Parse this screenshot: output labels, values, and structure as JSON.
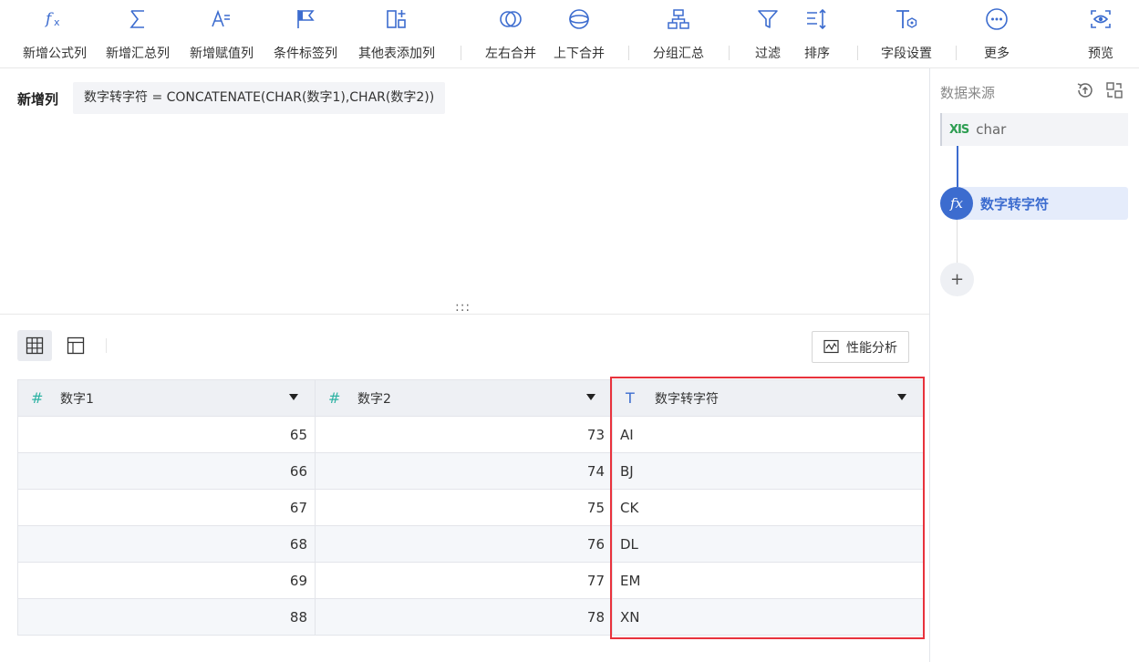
{
  "toolbar": {
    "items": [
      {
        "label": "新增公式列",
        "icon": "formula-icon"
      },
      {
        "label": "新增汇总列",
        "icon": "sigma-icon"
      },
      {
        "label": "新增赋值列",
        "icon": "assign-icon"
      },
      {
        "label": "条件标签列",
        "icon": "flag-icon"
      },
      {
        "label": "其他表添加列",
        "icon": "add-column-icon"
      },
      {
        "label": "左右合并",
        "icon": "horizontal-merge-icon"
      },
      {
        "label": "上下合并",
        "icon": "vertical-merge-icon"
      },
      {
        "label": "分组汇总",
        "icon": "group-icon"
      },
      {
        "label": "过滤",
        "icon": "filter-icon"
      },
      {
        "label": "排序",
        "icon": "sort-icon"
      },
      {
        "label": "字段设置",
        "icon": "field-settings-icon"
      },
      {
        "label": "更多",
        "icon": "more-icon"
      },
      {
        "label": "预览",
        "icon": "preview-icon"
      }
    ]
  },
  "formula": {
    "title": "新增列",
    "expression": "数字转字符 = CONCATENATE(CHAR(数字1),CHAR(数字2))"
  },
  "drag_handle": ":::",
  "perf_button": "性能分析",
  "table": {
    "columns": [
      {
        "name": "数字1",
        "type_icon": "#"
      },
      {
        "name": "数字2",
        "type_icon": "#"
      },
      {
        "name": "数字转字符",
        "type_icon": "T"
      }
    ],
    "rows": [
      [
        "65",
        "73",
        "AI"
      ],
      [
        "66",
        "74",
        "BJ"
      ],
      [
        "67",
        "75",
        "CK"
      ],
      [
        "68",
        "76",
        "DL"
      ],
      [
        "69",
        "77",
        "EM"
      ],
      [
        "88",
        "78",
        "XN"
      ]
    ]
  },
  "right_panel": {
    "title": "数据来源",
    "source": {
      "icon_text": "XIS",
      "label": "char"
    },
    "step": {
      "icon_text": "fx",
      "label": "数字转字符"
    },
    "add": "+"
  },
  "colors": {
    "accent": "#3c6ccf",
    "highlight": "#e8323c",
    "number_type": "#2fb3a4"
  }
}
